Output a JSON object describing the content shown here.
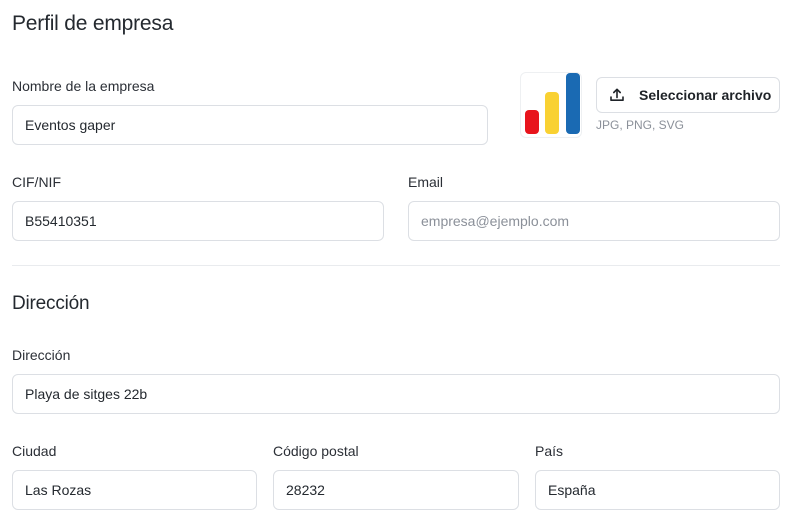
{
  "profile": {
    "title": "Perfil de empresa",
    "company_name_label": "Nombre de la empresa",
    "company_name_value": "Eventos gaper",
    "logo": {
      "bars": [
        {
          "color": "#e8141c",
          "level": 0.38
        },
        {
          "color": "#f9d132",
          "level": 0.67
        },
        {
          "color": "#1a6ab3",
          "level": 0.98
        }
      ]
    },
    "upload_button_label": "Seleccionar archivo",
    "upload_icon": "upload-icon",
    "file_types_hint": "JPG, PNG, SVG",
    "tax_id_label": "CIF/NIF",
    "tax_id_value": "B55410351",
    "email_label": "Email",
    "email_value": "",
    "email_placeholder": "empresa@ejemplo.com"
  },
  "address": {
    "title": "Dirección",
    "street_label": "Dirección",
    "street_value": "Playa de sitges 22b",
    "city_label": "Ciudad",
    "city_value": "Las Rozas",
    "postal_code_label": "Código postal",
    "postal_code_value": "28232",
    "country_label": "País",
    "country_value": "España"
  }
}
